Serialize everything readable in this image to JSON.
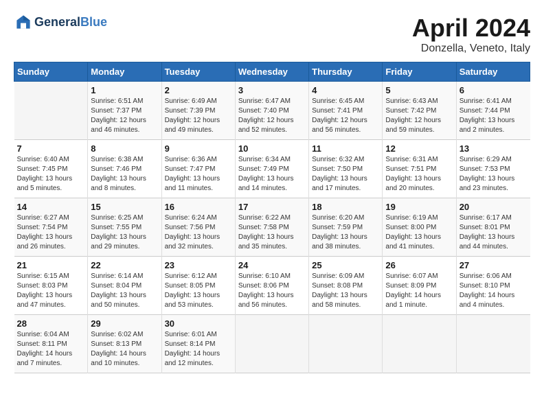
{
  "logo": {
    "text_general": "General",
    "text_blue": "Blue"
  },
  "title": {
    "month": "April 2024",
    "location": "Donzella, Veneto, Italy"
  },
  "weekdays": [
    "Sunday",
    "Monday",
    "Tuesday",
    "Wednesday",
    "Thursday",
    "Friday",
    "Saturday"
  ],
  "weeks": [
    [
      {
        "day": "",
        "info": ""
      },
      {
        "day": "1",
        "info": "Sunrise: 6:51 AM\nSunset: 7:37 PM\nDaylight: 12 hours\nand 46 minutes."
      },
      {
        "day": "2",
        "info": "Sunrise: 6:49 AM\nSunset: 7:39 PM\nDaylight: 12 hours\nand 49 minutes."
      },
      {
        "day": "3",
        "info": "Sunrise: 6:47 AM\nSunset: 7:40 PM\nDaylight: 12 hours\nand 52 minutes."
      },
      {
        "day": "4",
        "info": "Sunrise: 6:45 AM\nSunset: 7:41 PM\nDaylight: 12 hours\nand 56 minutes."
      },
      {
        "day": "5",
        "info": "Sunrise: 6:43 AM\nSunset: 7:42 PM\nDaylight: 12 hours\nand 59 minutes."
      },
      {
        "day": "6",
        "info": "Sunrise: 6:41 AM\nSunset: 7:44 PM\nDaylight: 13 hours\nand 2 minutes."
      }
    ],
    [
      {
        "day": "7",
        "info": "Sunrise: 6:40 AM\nSunset: 7:45 PM\nDaylight: 13 hours\nand 5 minutes."
      },
      {
        "day": "8",
        "info": "Sunrise: 6:38 AM\nSunset: 7:46 PM\nDaylight: 13 hours\nand 8 minutes."
      },
      {
        "day": "9",
        "info": "Sunrise: 6:36 AM\nSunset: 7:47 PM\nDaylight: 13 hours\nand 11 minutes."
      },
      {
        "day": "10",
        "info": "Sunrise: 6:34 AM\nSunset: 7:49 PM\nDaylight: 13 hours\nand 14 minutes."
      },
      {
        "day": "11",
        "info": "Sunrise: 6:32 AM\nSunset: 7:50 PM\nDaylight: 13 hours\nand 17 minutes."
      },
      {
        "day": "12",
        "info": "Sunrise: 6:31 AM\nSunset: 7:51 PM\nDaylight: 13 hours\nand 20 minutes."
      },
      {
        "day": "13",
        "info": "Sunrise: 6:29 AM\nSunset: 7:53 PM\nDaylight: 13 hours\nand 23 minutes."
      }
    ],
    [
      {
        "day": "14",
        "info": "Sunrise: 6:27 AM\nSunset: 7:54 PM\nDaylight: 13 hours\nand 26 minutes."
      },
      {
        "day": "15",
        "info": "Sunrise: 6:25 AM\nSunset: 7:55 PM\nDaylight: 13 hours\nand 29 minutes."
      },
      {
        "day": "16",
        "info": "Sunrise: 6:24 AM\nSunset: 7:56 PM\nDaylight: 13 hours\nand 32 minutes."
      },
      {
        "day": "17",
        "info": "Sunrise: 6:22 AM\nSunset: 7:58 PM\nDaylight: 13 hours\nand 35 minutes."
      },
      {
        "day": "18",
        "info": "Sunrise: 6:20 AM\nSunset: 7:59 PM\nDaylight: 13 hours\nand 38 minutes."
      },
      {
        "day": "19",
        "info": "Sunrise: 6:19 AM\nSunset: 8:00 PM\nDaylight: 13 hours\nand 41 minutes."
      },
      {
        "day": "20",
        "info": "Sunrise: 6:17 AM\nSunset: 8:01 PM\nDaylight: 13 hours\nand 44 minutes."
      }
    ],
    [
      {
        "day": "21",
        "info": "Sunrise: 6:15 AM\nSunset: 8:03 PM\nDaylight: 13 hours\nand 47 minutes."
      },
      {
        "day": "22",
        "info": "Sunrise: 6:14 AM\nSunset: 8:04 PM\nDaylight: 13 hours\nand 50 minutes."
      },
      {
        "day": "23",
        "info": "Sunrise: 6:12 AM\nSunset: 8:05 PM\nDaylight: 13 hours\nand 53 minutes."
      },
      {
        "day": "24",
        "info": "Sunrise: 6:10 AM\nSunset: 8:06 PM\nDaylight: 13 hours\nand 56 minutes."
      },
      {
        "day": "25",
        "info": "Sunrise: 6:09 AM\nSunset: 8:08 PM\nDaylight: 13 hours\nand 58 minutes."
      },
      {
        "day": "26",
        "info": "Sunrise: 6:07 AM\nSunset: 8:09 PM\nDaylight: 14 hours\nand 1 minute."
      },
      {
        "day": "27",
        "info": "Sunrise: 6:06 AM\nSunset: 8:10 PM\nDaylight: 14 hours\nand 4 minutes."
      }
    ],
    [
      {
        "day": "28",
        "info": "Sunrise: 6:04 AM\nSunset: 8:11 PM\nDaylight: 14 hours\nand 7 minutes."
      },
      {
        "day": "29",
        "info": "Sunrise: 6:02 AM\nSunset: 8:13 PM\nDaylight: 14 hours\nand 10 minutes."
      },
      {
        "day": "30",
        "info": "Sunrise: 6:01 AM\nSunset: 8:14 PM\nDaylight: 14 hours\nand 12 minutes."
      },
      {
        "day": "",
        "info": ""
      },
      {
        "day": "",
        "info": ""
      },
      {
        "day": "",
        "info": ""
      },
      {
        "day": "",
        "info": ""
      }
    ]
  ]
}
